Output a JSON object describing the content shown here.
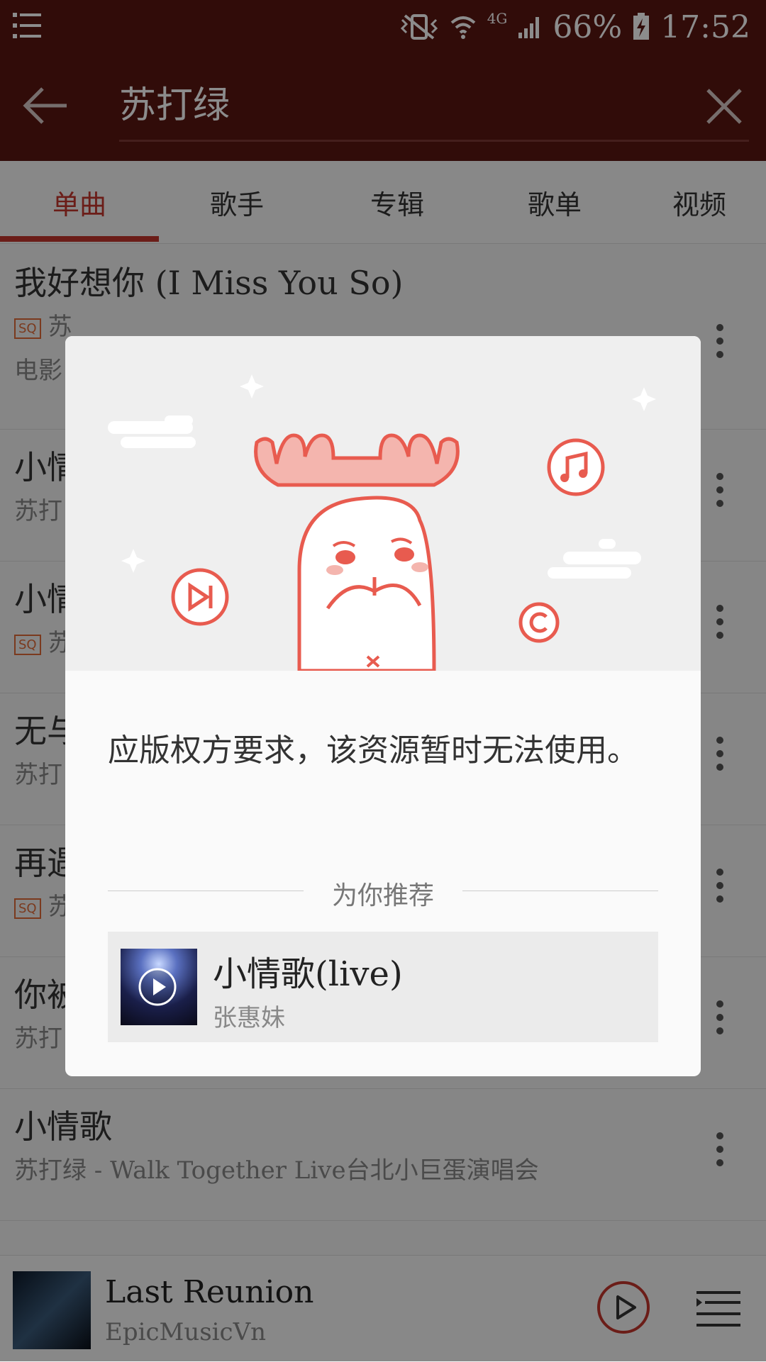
{
  "status_bar": {
    "battery_percent": "66%",
    "time": "17:52",
    "network": "4G"
  },
  "search": {
    "value": "苏打绿"
  },
  "tabs": [
    {
      "label": "单曲",
      "active": true
    },
    {
      "label": "歌手",
      "active": false
    },
    {
      "label": "专辑",
      "active": false
    },
    {
      "label": "歌单",
      "active": false
    },
    {
      "label": "视频",
      "active": false
    }
  ],
  "results": [
    {
      "title": "我好想你 (I Miss You So)",
      "badge": "SQ",
      "sub_line": "苏",
      "sub_line2": "电影"
    },
    {
      "title": "小情",
      "sub_line": "苏打"
    },
    {
      "title": "小情",
      "badge": "SQ",
      "sub_line": "苏"
    },
    {
      "title": "无与",
      "sub_line": "苏打"
    },
    {
      "title": "再遇",
      "badge": "SQ",
      "sub_line": "苏"
    },
    {
      "title": "你被",
      "sub_line": "苏打"
    },
    {
      "title": "小情歌",
      "sub_line": "苏打绿 - Walk Together Live台北小巨蛋演唱会"
    }
  ],
  "dialog": {
    "message": "应版权方要求，该资源暂时无法使用。",
    "recommend_label": "为你推荐",
    "recommend_item": {
      "title": "小情歌(live)",
      "artist": "张惠妹"
    }
  },
  "now_playing": {
    "title": "Last Reunion",
    "artist": "EpicMusicVn"
  },
  "colors": {
    "header": "#5a1612",
    "accent": "#c3352c",
    "illustration": "#e85b4f"
  }
}
